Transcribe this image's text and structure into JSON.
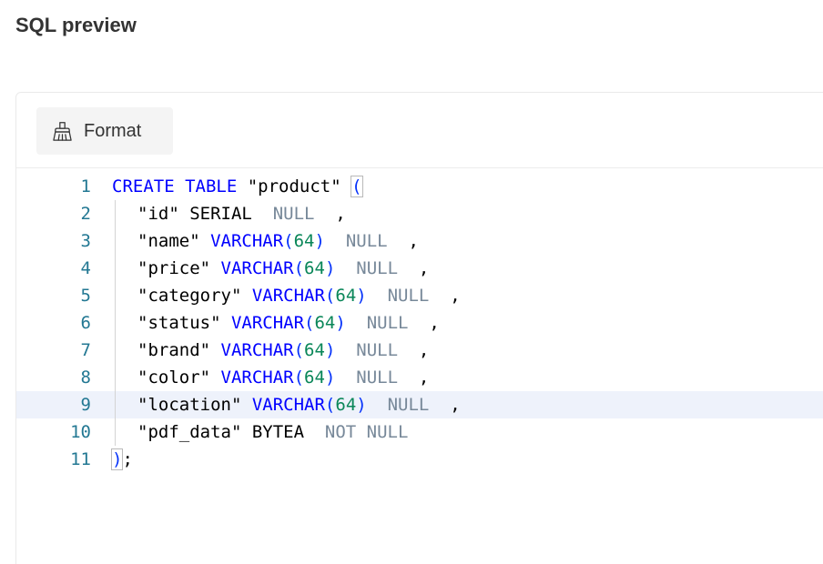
{
  "title": "SQL preview",
  "toolbar": {
    "format_label": "Format",
    "format_icon": "brush-icon"
  },
  "editor": {
    "active_line": 9,
    "colors": {
      "keyword": "#0000ff",
      "number": "#098658",
      "null": "#778899",
      "bracket": "#0431fa",
      "line_number": "#237893"
    },
    "lines": [
      {
        "n": "1",
        "indent": false,
        "tokens": [
          {
            "t": "CREATE TABLE",
            "c": "kw"
          },
          {
            "t": " \"product\" ",
            "c": ""
          },
          {
            "t": "(",
            "c": "br-hl"
          }
        ]
      },
      {
        "n": "2",
        "indent": true,
        "tokens": [
          {
            "t": "\"id\" SERIAL  ",
            "c": ""
          },
          {
            "t": "NULL",
            "c": "nul"
          },
          {
            "t": "  ,",
            "c": ""
          }
        ]
      },
      {
        "n": "3",
        "indent": true,
        "tokens": [
          {
            "t": "\"name\" ",
            "c": ""
          },
          {
            "t": "VARCHAR",
            "c": "kw"
          },
          {
            "t": "(",
            "c": "br"
          },
          {
            "t": "64",
            "c": "num"
          },
          {
            "t": ")",
            "c": "br"
          },
          {
            "t": "  ",
            "c": ""
          },
          {
            "t": "NULL",
            "c": "nul"
          },
          {
            "t": "  ,",
            "c": ""
          }
        ]
      },
      {
        "n": "4",
        "indent": true,
        "tokens": [
          {
            "t": "\"price\" ",
            "c": ""
          },
          {
            "t": "VARCHAR",
            "c": "kw"
          },
          {
            "t": "(",
            "c": "br"
          },
          {
            "t": "64",
            "c": "num"
          },
          {
            "t": ")",
            "c": "br"
          },
          {
            "t": "  ",
            "c": ""
          },
          {
            "t": "NULL",
            "c": "nul"
          },
          {
            "t": "  ,",
            "c": ""
          }
        ]
      },
      {
        "n": "5",
        "indent": true,
        "tokens": [
          {
            "t": "\"category\" ",
            "c": ""
          },
          {
            "t": "VARCHAR",
            "c": "kw"
          },
          {
            "t": "(",
            "c": "br"
          },
          {
            "t": "64",
            "c": "num"
          },
          {
            "t": ")",
            "c": "br"
          },
          {
            "t": "  ",
            "c": ""
          },
          {
            "t": "NULL",
            "c": "nul"
          },
          {
            "t": "  ,",
            "c": ""
          }
        ]
      },
      {
        "n": "6",
        "indent": true,
        "tokens": [
          {
            "t": "\"status\" ",
            "c": ""
          },
          {
            "t": "VARCHAR",
            "c": "kw"
          },
          {
            "t": "(",
            "c": "br"
          },
          {
            "t": "64",
            "c": "num"
          },
          {
            "t": ")",
            "c": "br"
          },
          {
            "t": "  ",
            "c": ""
          },
          {
            "t": "NULL",
            "c": "nul"
          },
          {
            "t": "  ,",
            "c": ""
          }
        ]
      },
      {
        "n": "7",
        "indent": true,
        "tokens": [
          {
            "t": "\"brand\" ",
            "c": ""
          },
          {
            "t": "VARCHAR",
            "c": "kw"
          },
          {
            "t": "(",
            "c": "br"
          },
          {
            "t": "64",
            "c": "num"
          },
          {
            "t": ")",
            "c": "br"
          },
          {
            "t": "  ",
            "c": ""
          },
          {
            "t": "NULL",
            "c": "nul"
          },
          {
            "t": "  ,",
            "c": ""
          }
        ]
      },
      {
        "n": "8",
        "indent": true,
        "tokens": [
          {
            "t": "\"color\" ",
            "c": ""
          },
          {
            "t": "VARCHAR",
            "c": "kw"
          },
          {
            "t": "(",
            "c": "br"
          },
          {
            "t": "64",
            "c": "num"
          },
          {
            "t": ")",
            "c": "br"
          },
          {
            "t": "  ",
            "c": ""
          },
          {
            "t": "NULL",
            "c": "nul"
          },
          {
            "t": "  ,",
            "c": ""
          }
        ]
      },
      {
        "n": "9",
        "indent": true,
        "tokens": [
          {
            "t": "\"location\" ",
            "c": ""
          },
          {
            "t": "VARCHAR",
            "c": "kw"
          },
          {
            "t": "(",
            "c": "br"
          },
          {
            "t": "64",
            "c": "num"
          },
          {
            "t": ")",
            "c": "br"
          },
          {
            "t": "  ",
            "c": ""
          },
          {
            "t": "NULL",
            "c": "nul"
          },
          {
            "t": "  ,",
            "c": ""
          }
        ]
      },
      {
        "n": "10",
        "indent": true,
        "tokens": [
          {
            "t": "\"pdf_data\" BYTEA  ",
            "c": ""
          },
          {
            "t": "NOT NULL",
            "c": "nul"
          }
        ]
      },
      {
        "n": "11",
        "indent": false,
        "tokens": [
          {
            "t": ")",
            "c": "br-hl"
          },
          {
            "t": ";",
            "c": ""
          }
        ]
      }
    ]
  }
}
